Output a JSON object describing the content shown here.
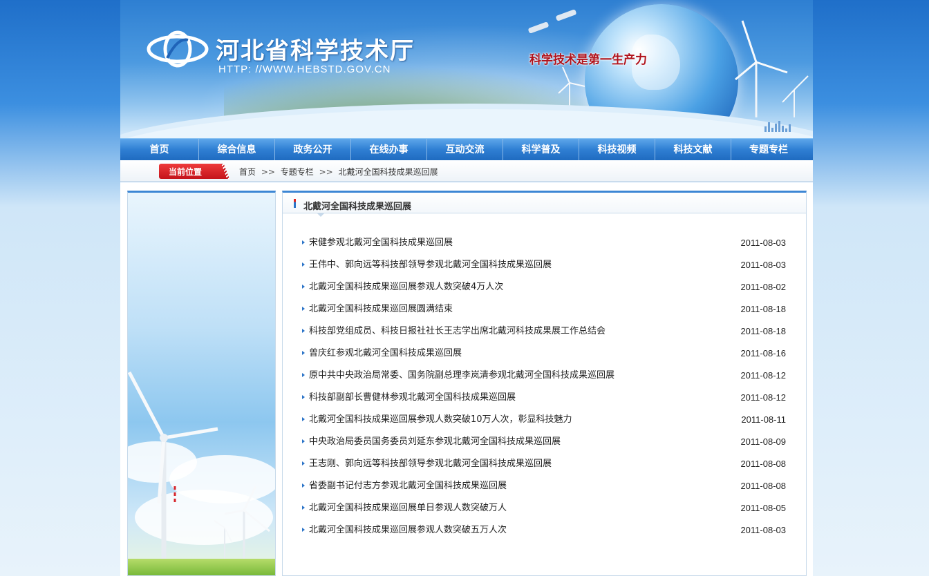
{
  "header": {
    "site_title": "河北省科学技术厅",
    "site_url": "HTTP: //WWW.HEBSTD.GOV.CN",
    "slogan": "科学技术是第一生产力"
  },
  "nav": {
    "items": [
      "首页",
      "综合信息",
      "政务公开",
      "在线办事",
      "互动交流",
      "科学普及",
      "科技视频",
      "科技文献",
      "专题专栏"
    ]
  },
  "breadcrumb": {
    "badge": "当前位置",
    "home": "首页",
    "separator": ">>",
    "section": "专题专栏",
    "current": "北戴河全国科技成果巡回展"
  },
  "main": {
    "heading": "北戴河全国科技成果巡回展",
    "articles": [
      {
        "title": "宋健参观北戴河全国科技成果巡回展",
        "date": "2011-08-03"
      },
      {
        "title": "王伟中、郭向远等科技部领导参观北戴河全国科技成果巡回展",
        "date": "2011-08-03"
      },
      {
        "title": "北戴河全国科技成果巡回展参观人数突破4万人次",
        "date": "2011-08-02"
      },
      {
        "title": "北戴河全国科技成果巡回展圆满结束",
        "date": "2011-08-18"
      },
      {
        "title": "科技部党组成员、科技日报社社长王志学出席北戴河科技成果展工作总结会",
        "date": "2011-08-18"
      },
      {
        "title": "曾庆红参观北戴河全国科技成果巡回展",
        "date": "2011-08-16"
      },
      {
        "title": "原中共中央政治局常委、国务院副总理李岚清参观北戴河全国科技成果巡回展",
        "date": "2011-08-12"
      },
      {
        "title": "科技部副部长曹健林参观北戴河全国科技成果巡回展",
        "date": "2011-08-12"
      },
      {
        "title": "北戴河全国科技成果巡回展参观人数突破10万人次，彰显科技魅力",
        "date": "2011-08-11"
      },
      {
        "title": "中央政治局委员国务委员刘延东参观北戴河全国科技成果巡回展",
        "date": "2011-08-09"
      },
      {
        "title": "王志刚、郭向远等科技部领导参观北戴河全国科技成果巡回展",
        "date": "2011-08-08"
      },
      {
        "title": "省委副书记付志方参观北戴河全国科技成果巡回展",
        "date": "2011-08-08"
      },
      {
        "title": "北戴河全国科技成果巡回展单日参观人数突破万人",
        "date": "2011-08-05"
      },
      {
        "title": "北戴河全国科技成果巡回展参观人数突破五万人次",
        "date": "2011-08-03"
      }
    ]
  },
  "colors": {
    "nav_blue": "#2f7fd3",
    "accent_red": "#c4131b",
    "link_blue": "#2b74c8"
  }
}
